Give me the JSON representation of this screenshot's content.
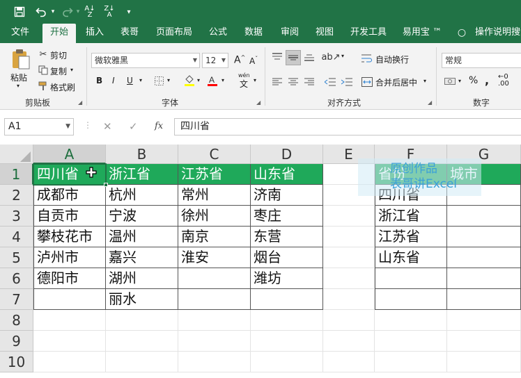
{
  "qat": {
    "save_icon": "save-icon",
    "undo_icon": "undo-icon",
    "redo_icon": "redo-icon",
    "sort_asc_icon": "sort-ascending-icon",
    "sort_desc_icon": "sort-descending-icon",
    "customize_icon": "customize-qat-icon",
    "sort_asc_label": "A↓Z",
    "sort_desc_label": "Z↓A"
  },
  "tabs": [
    {
      "label": "文件"
    },
    {
      "label": "开始",
      "active": true
    },
    {
      "label": "插入"
    },
    {
      "label": "表哥"
    },
    {
      "label": "页面布局"
    },
    {
      "label": "公式"
    },
    {
      "label": "数据"
    },
    {
      "label": "审阅"
    },
    {
      "label": "视图"
    },
    {
      "label": "开发工具"
    },
    {
      "label": "易用宝 ™"
    },
    {
      "label": "操作说明搜索"
    }
  ],
  "ribbon": {
    "clipboard": {
      "paste": "粘贴",
      "cut": "剪切",
      "copy": "复制",
      "format_painter": "格式刷",
      "group": "剪贴板"
    },
    "font": {
      "name": "微软雅黑",
      "size": "12",
      "bold": "B",
      "italic": "I",
      "underline": "U",
      "increase": "A",
      "decrease": "A",
      "wen": "wén",
      "wen2": "文",
      "group": "字体"
    },
    "alignment": {
      "wrap": "自动换行",
      "merge": "合并后居中",
      "group": "对齐方式"
    },
    "number": {
      "format": "常规",
      "percent": "%",
      "comma": ",",
      "group": "数字"
    }
  },
  "formula_bar": {
    "name_box": "A1",
    "fx": "fx",
    "value": "四川省"
  },
  "grid": {
    "columns": [
      "A",
      "B",
      "C",
      "D",
      "E",
      "F",
      "G"
    ],
    "rows": [
      "1",
      "2",
      "3",
      "4",
      "5",
      "6",
      "7",
      "8",
      "9",
      "10"
    ],
    "table1": [
      [
        "四川省",
        "浙江省",
        "江苏省",
        "山东省"
      ],
      [
        "成都市",
        "杭州",
        "常州",
        "济南"
      ],
      [
        "自贡市",
        "宁波",
        "徐州",
        "枣庄"
      ],
      [
        "攀枝花市",
        "温州",
        "南京",
        "东营"
      ],
      [
        "泸州市",
        "嘉兴",
        "淮安",
        "烟台"
      ],
      [
        "德阳市",
        "湖州",
        "",
        "潍坊"
      ],
      [
        "",
        "丽水",
        "",
        ""
      ]
    ],
    "table2": [
      [
        "省份",
        "城市"
      ],
      [
        "四川省",
        ""
      ],
      [
        "浙江省",
        ""
      ],
      [
        "江苏省",
        ""
      ],
      [
        "山东省",
        ""
      ],
      [
        "",
        ""
      ],
      [
        "",
        ""
      ]
    ],
    "header_color": "#1fa95a"
  },
  "watermark": {
    "line1": "原创作品",
    "line2": "表哥讲Excel"
  },
  "colors": {
    "excel_green": "#217346",
    "header_fill": "#1fa95a"
  }
}
